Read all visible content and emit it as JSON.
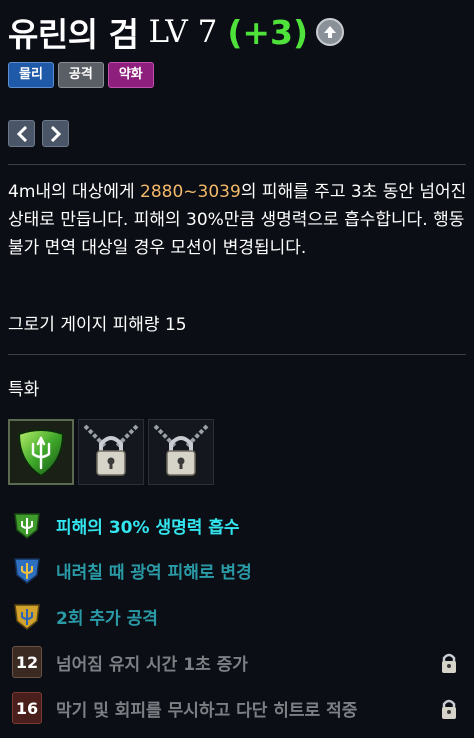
{
  "title": {
    "name": "유린의 검",
    "level": "LV 7",
    "bonus": "(+3)"
  },
  "tags": [
    "물리",
    "공격",
    "약화"
  ],
  "description": {
    "before": "4m내의 대상에게 ",
    "damage": "2880~3039",
    "after": "의 피해를 주고 3초 동안 넘어진 상태로 만듭니다. 피해의 30%만큼 생명력으로 흡수합니다. 행동불가 면역 대상일 경우 모션이 변경됩니다."
  },
  "gauge_text": "그로기 게이지 피해량 15",
  "specialization": {
    "title": "특화",
    "slots": [
      {
        "icon": "green-gem-trident-icon",
        "state": "equipped"
      },
      {
        "icon": "chained-lock-icon",
        "state": "locked"
      },
      {
        "icon": "chained-lock-icon",
        "state": "locked"
      }
    ]
  },
  "traits": [
    {
      "badge": "",
      "label": "피해의 30% 생명력 흡수",
      "color": "#33e5ee",
      "icon": "green-trident-badge-icon",
      "locked": false
    },
    {
      "badge": "",
      "label": "내려칠 때 광역 피해로 변경",
      "color": "#2a9aa6",
      "icon": "blue-trident-badge-icon",
      "locked": false
    },
    {
      "badge": "",
      "label": "2회 추가 공격",
      "color": "#2a9aa6",
      "icon": "gold-trident-badge-icon",
      "locked": false
    },
    {
      "badge": "12",
      "label": "넘어짐 유지 시간 1초 증가",
      "color": "#7c7f84",
      "icon": "level-badge-icon",
      "locked": true
    },
    {
      "badge": "16",
      "label": "막기 및 회피를 무시하고 다단 히트로 적중",
      "color": "#7c7f84",
      "icon": "level-badge-icon",
      "locked": true
    }
  ],
  "colors": {
    "bonus": "#4fe23a",
    "damage": "#f4b96a",
    "tag_physical": "#1f5aa8",
    "tag_attack": "#5a5f66",
    "tag_debuff": "#8e1f7c"
  }
}
